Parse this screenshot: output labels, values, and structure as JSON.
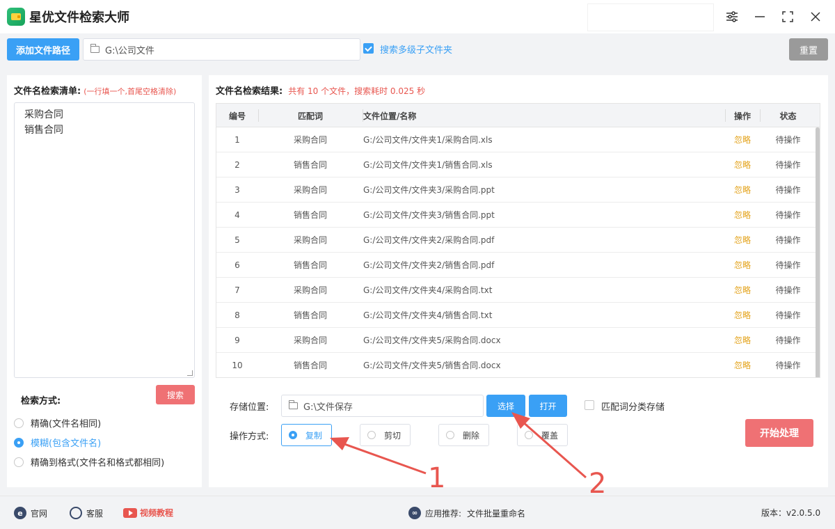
{
  "app": {
    "title": "星优文件检索大师"
  },
  "toolbar": {
    "add_path_label": "添加文件路径",
    "path_value": "G:\\公司文件",
    "subfolder_label": "搜索多级子文件夹",
    "subfolder_checked": true,
    "reset_label": "重置"
  },
  "left": {
    "heading": "文件名检索清单:",
    "hint": "(一行填一个,首尾空格清除)",
    "keywords": [
      "采购合同",
      "销售合同"
    ],
    "search_button": "搜索",
    "mode_label": "检索方式:",
    "modes": [
      {
        "label": "精确(文件名相同)",
        "selected": false
      },
      {
        "label": "模糊(包含文件名)",
        "selected": true
      },
      {
        "label": "精确到格式(文件名和格式都相同)",
        "selected": false
      }
    ]
  },
  "results": {
    "heading": "文件名检索结果:",
    "summary": "共有 10 个文件，搜索耗时 0.025 秒",
    "columns": [
      "编号",
      "匹配词",
      "文件位置/名称",
      "操作",
      "状态"
    ],
    "rows": [
      {
        "no": "1",
        "keyword": "采购合同",
        "path": "G:/公司文件/文件夹1/采购合同.xls",
        "op": "忽略",
        "status": "待操作"
      },
      {
        "no": "2",
        "keyword": "销售合同",
        "path": "G:/公司文件/文件夹1/销售合同.xls",
        "op": "忽略",
        "status": "待操作"
      },
      {
        "no": "3",
        "keyword": "采购合同",
        "path": "G:/公司文件/文件夹3/采购合同.ppt",
        "op": "忽略",
        "status": "待操作"
      },
      {
        "no": "4",
        "keyword": "销售合同",
        "path": "G:/公司文件/文件夹3/销售合同.ppt",
        "op": "忽略",
        "status": "待操作"
      },
      {
        "no": "5",
        "keyword": "采购合同",
        "path": "G:/公司文件/文件夹2/采购合同.pdf",
        "op": "忽略",
        "status": "待操作"
      },
      {
        "no": "6",
        "keyword": "销售合同",
        "path": "G:/公司文件/文件夹2/销售合同.pdf",
        "op": "忽略",
        "status": "待操作"
      },
      {
        "no": "7",
        "keyword": "采购合同",
        "path": "G:/公司文件/文件夹4/采购合同.txt",
        "op": "忽略",
        "status": "待操作"
      },
      {
        "no": "8",
        "keyword": "销售合同",
        "path": "G:/公司文件/文件夹4/销售合同.txt",
        "op": "忽略",
        "status": "待操作"
      },
      {
        "no": "9",
        "keyword": "采购合同",
        "path": "G:/公司文件/文件夹5/采购合同.docx",
        "op": "忽略",
        "status": "待操作"
      },
      {
        "no": "10",
        "keyword": "销售合同",
        "path": "G:/公司文件/文件夹5/销售合同.docx",
        "op": "忽略",
        "status": "待操作"
      }
    ]
  },
  "storage": {
    "label": "存储位置:",
    "path_value": "G:\\文件保存",
    "choose_label": "选择",
    "open_label": "打开",
    "classify_label": "匹配词分类存储",
    "classify_checked": false
  },
  "operation": {
    "label": "操作方式:",
    "options": [
      {
        "label": "复制",
        "selected": true
      },
      {
        "label": "剪切",
        "selected": false
      },
      {
        "label": "删除",
        "selected": false
      },
      {
        "label": "覆盖",
        "selected": false
      }
    ],
    "start_label": "开始处理"
  },
  "annotations": {
    "arrow1_number": "1",
    "arrow2_number": "2",
    "color": "#e8564f"
  },
  "footer": {
    "website": "官网",
    "support": "客服",
    "video": "视频教程",
    "recommend_prefix": "应用推荐:",
    "recommend_app": "文件批量重命名",
    "version": "版本：v2.0.5.0"
  },
  "colors": {
    "primary": "#3aa0f5",
    "danger": "#ef7174",
    "warning": "#e3a21a",
    "reset": "#9a9a9a"
  }
}
